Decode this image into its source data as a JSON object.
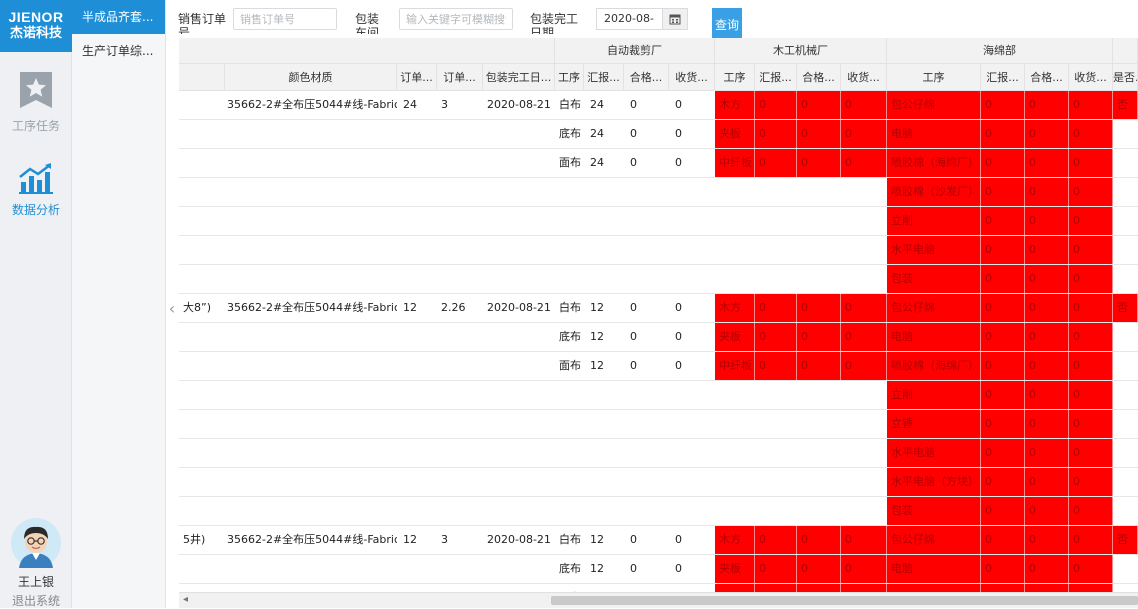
{
  "brand": {
    "en": "JIENOR",
    "cn": "杰诺科技"
  },
  "nav": [
    {
      "label": "工序任务",
      "icon": "star-icon"
    },
    {
      "label": "数据分析",
      "icon": "chart-icon"
    }
  ],
  "user": {
    "name": "王上银",
    "logout": "退出系统"
  },
  "subnav": [
    {
      "label": "半成品齐套...",
      "active": true
    },
    {
      "label": "生产订单综...",
      "active": false
    }
  ],
  "filters": {
    "sales_order_label": "销售订单号",
    "sales_order_placeholder": "销售订单号",
    "workshop_label": "包装车间",
    "workshop_placeholder": "输入关键字可模糊搜索",
    "date_label": "包装完工日期",
    "date_value": "2020-08-",
    "query_label": "查询"
  },
  "groups": [
    {
      "label": "自动裁剪厂"
    },
    {
      "label": "木工机械厂"
    },
    {
      "label": "海绵部"
    }
  ],
  "columns": {
    "color": "颜色材质",
    "qty": "订单...",
    "qty2": "订单...",
    "date": "包装完工日...",
    "proc": "工序",
    "report": "汇报...",
    "pass": "合格...",
    "recv": "收货...",
    "proc2": "工序",
    "report2": "汇报...",
    "pass2": "合格...",
    "recv2": "收货...",
    "proc3": "工序",
    "report3": "汇报...",
    "pass3": "合格...",
    "recv3": "收货...",
    "flag": "是否..."
  },
  "rows": [
    {
      "prefix": "",
      "color": "35662-2#全布压5044#线-Fabric",
      "qty": "24",
      "qty2": "3",
      "date": "2020-08-21",
      "proc": "白布",
      "report": "24",
      "pass": "0",
      "recv": "0",
      "wood": "木方",
      "w_r": "0",
      "w_p": "0",
      "w_v": "0",
      "sponge": "包公仔绵",
      "s_r": "0",
      "s_p": "0",
      "s_v": "0",
      "flag": "否"
    },
    {
      "prefix": "",
      "color": "",
      "qty": "",
      "qty2": "",
      "date": "",
      "proc": "底布",
      "report": "24",
      "pass": "0",
      "recv": "0",
      "wood": "夹板",
      "w_r": "0",
      "w_p": "0",
      "w_v": "0",
      "sponge": "电脑",
      "s_r": "0",
      "s_p": "0",
      "s_v": "0",
      "flag": ""
    },
    {
      "prefix": "",
      "color": "",
      "qty": "",
      "qty2": "",
      "date": "",
      "proc": "面布",
      "report": "24",
      "pass": "0",
      "recv": "0",
      "wood": "中纤板",
      "w_r": "0",
      "w_p": "0",
      "w_v": "0",
      "sponge": "喷胶棉（海绵厂）",
      "s_r": "0",
      "s_p": "0",
      "s_v": "0",
      "flag": ""
    },
    {
      "prefix": "",
      "color": "",
      "qty": "",
      "qty2": "",
      "date": "",
      "proc": "",
      "report": "",
      "pass": "",
      "recv": "",
      "wood": "",
      "w_r": "",
      "w_p": "",
      "w_v": "",
      "sponge": "喷胶棉（沙发厂）",
      "s_r": "0",
      "s_p": "0",
      "s_v": "0",
      "flag": ""
    },
    {
      "prefix": "",
      "color": "",
      "qty": "",
      "qty2": "",
      "date": "",
      "proc": "",
      "report": "",
      "pass": "",
      "recv": "",
      "wood": "",
      "w_r": "",
      "w_p": "",
      "w_v": "",
      "sponge": "立削",
      "s_r": "0",
      "s_p": "0",
      "s_v": "0",
      "flag": ""
    },
    {
      "prefix": "",
      "color": "",
      "qty": "",
      "qty2": "",
      "date": "",
      "proc": "",
      "report": "",
      "pass": "",
      "recv": "",
      "wood": "",
      "w_r": "",
      "w_p": "",
      "w_v": "",
      "sponge": "水平电脑",
      "s_r": "0",
      "s_p": "0",
      "s_v": "0",
      "flag": ""
    },
    {
      "prefix": "",
      "color": "",
      "qty": "",
      "qty2": "",
      "date": "",
      "proc": "",
      "report": "",
      "pass": "",
      "recv": "",
      "wood": "",
      "w_r": "",
      "w_p": "",
      "w_v": "",
      "sponge": "包装",
      "s_r": "0",
      "s_p": "0",
      "s_v": "0",
      "flag": ""
    },
    {
      "prefix": "大8”)",
      "color": "35662-2#全布压5044#线-Fabric",
      "qty": "12",
      "qty2": "2.26",
      "date": "2020-08-21",
      "proc": "白布",
      "report": "12",
      "pass": "0",
      "recv": "0",
      "wood": "木方",
      "w_r": "0",
      "w_p": "0",
      "w_v": "0",
      "sponge": "包公仔绵",
      "s_r": "0",
      "s_p": "0",
      "s_v": "0",
      "flag": "否"
    },
    {
      "prefix": "",
      "color": "",
      "qty": "",
      "qty2": "",
      "date": "",
      "proc": "底布",
      "report": "12",
      "pass": "0",
      "recv": "0",
      "wood": "夹板",
      "w_r": "0",
      "w_p": "0",
      "w_v": "0",
      "sponge": "电脑",
      "s_r": "0",
      "s_p": "0",
      "s_v": "0",
      "flag": ""
    },
    {
      "prefix": "",
      "color": "",
      "qty": "",
      "qty2": "",
      "date": "",
      "proc": "面布",
      "report": "12",
      "pass": "0",
      "recv": "0",
      "wood": "中纤板",
      "w_r": "0",
      "w_p": "0",
      "w_v": "0",
      "sponge": "喷胶棉（海绵厂）",
      "s_r": "0",
      "s_p": "0",
      "s_v": "0",
      "flag": ""
    },
    {
      "prefix": "",
      "color": "",
      "qty": "",
      "qty2": "",
      "date": "",
      "proc": "",
      "report": "",
      "pass": "",
      "recv": "",
      "wood": "",
      "w_r": "",
      "w_p": "",
      "w_v": "",
      "sponge": "立削",
      "s_r": "0",
      "s_p": "0",
      "s_v": "0",
      "flag": ""
    },
    {
      "prefix": "",
      "color": "",
      "qty": "",
      "qty2": "",
      "date": "",
      "proc": "",
      "report": "",
      "pass": "",
      "recv": "",
      "wood": "",
      "w_r": "",
      "w_p": "",
      "w_v": "",
      "sponge": "立锤",
      "s_r": "0",
      "s_p": "0",
      "s_v": "0",
      "flag": ""
    },
    {
      "prefix": "",
      "color": "",
      "qty": "",
      "qty2": "",
      "date": "",
      "proc": "",
      "report": "",
      "pass": "",
      "recv": "",
      "wood": "",
      "w_r": "",
      "w_p": "",
      "w_v": "",
      "sponge": "水平电脑",
      "s_r": "0",
      "s_p": "0",
      "s_v": "0",
      "flag": ""
    },
    {
      "prefix": "",
      "color": "",
      "qty": "",
      "qty2": "",
      "date": "",
      "proc": "",
      "report": "",
      "pass": "",
      "recv": "",
      "wood": "",
      "w_r": "",
      "w_p": "",
      "w_v": "",
      "sponge": "水平电脑（方块）",
      "s_r": "0",
      "s_p": "0",
      "s_v": "0",
      "flag": ""
    },
    {
      "prefix": "",
      "color": "",
      "qty": "",
      "qty2": "",
      "date": "",
      "proc": "",
      "report": "",
      "pass": "",
      "recv": "",
      "wood": "",
      "w_r": "",
      "w_p": "",
      "w_v": "",
      "sponge": "包装",
      "s_r": "0",
      "s_p": "0",
      "s_v": "0",
      "flag": ""
    },
    {
      "prefix": "5井)",
      "color": "35662-2#全布压5044#线-Fabric",
      "qty": "12",
      "qty2": "3",
      "date": "2020-08-21",
      "proc": "白布",
      "report": "12",
      "pass": "0",
      "recv": "0",
      "wood": "木方",
      "w_r": "0",
      "w_p": "0",
      "w_v": "0",
      "sponge": "包公仔绵",
      "s_r": "0",
      "s_p": "0",
      "s_v": "0",
      "flag": "否"
    },
    {
      "prefix": "",
      "color": "",
      "qty": "",
      "qty2": "",
      "date": "",
      "proc": "底布",
      "report": "12",
      "pass": "0",
      "recv": "0",
      "wood": "夹板",
      "w_r": "0",
      "w_p": "0",
      "w_v": "0",
      "sponge": "电脑",
      "s_r": "0",
      "s_p": "0",
      "s_v": "0",
      "flag": ""
    },
    {
      "prefix": "",
      "color": "",
      "qty": "",
      "qty2": "",
      "date": "",
      "proc": "面布",
      "report": "12",
      "pass": "0",
      "recv": "0",
      "wood": "中纤板",
      "w_r": "0",
      "w_p": "0",
      "w_v": "0",
      "sponge": "喷胶棉（海绵厂）",
      "s_r": "0",
      "s_p": "0",
      "s_v": "0",
      "flag": ""
    }
  ],
  "colors": {
    "brand": "#1e8fd6",
    "alert": "#ff0000"
  }
}
